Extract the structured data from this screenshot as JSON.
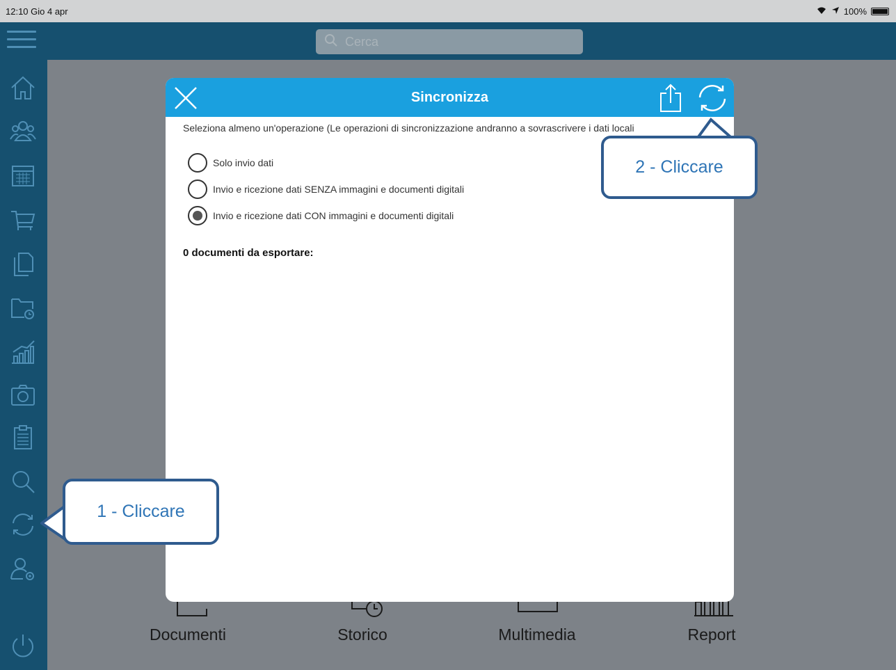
{
  "status_bar": {
    "time_date": "12:10  Gio 4 apr",
    "battery": "100%"
  },
  "search": {
    "placeholder": "Cerca"
  },
  "sidebar": {
    "items": [
      {
        "name": "home-icon"
      },
      {
        "name": "customers-icon"
      },
      {
        "name": "calendar-icon"
      },
      {
        "name": "cart-icon"
      },
      {
        "name": "documents-icon"
      },
      {
        "name": "history-folder-icon"
      },
      {
        "name": "report-chart-icon"
      },
      {
        "name": "camera-icon"
      },
      {
        "name": "clipboard-icon"
      },
      {
        "name": "search-icon"
      },
      {
        "name": "sync-icon"
      },
      {
        "name": "user-settings-icon"
      },
      {
        "name": "power-icon"
      }
    ]
  },
  "bottom_bar": {
    "items": [
      {
        "label": "Documenti"
      },
      {
        "label": "Storico"
      },
      {
        "label": "Multimedia"
      },
      {
        "label": "Report"
      }
    ]
  },
  "modal": {
    "title": "Sincronizza",
    "instruction": "Seleziona almeno un'operazione (Le operazioni di sincronizzazione andranno a sovrascrivere i dati locali",
    "options": [
      {
        "label": "Solo invio dati",
        "checked": false
      },
      {
        "label": "Invio e ricezione dati SENZA immagini e documenti digitali",
        "checked": false
      },
      {
        "label": "Invio e ricezione dati CON immagini e documenti digitali",
        "checked": true
      }
    ],
    "documents_count": "0 documenti da esportare:"
  },
  "callouts": {
    "first": "1 - Cliccare",
    "second": "2 - Cliccare"
  },
  "colors": {
    "header": "#1aa0df",
    "sidebar": "#16506f",
    "callout_border": "#2f5b8e",
    "callout_text": "#2f75b6"
  }
}
